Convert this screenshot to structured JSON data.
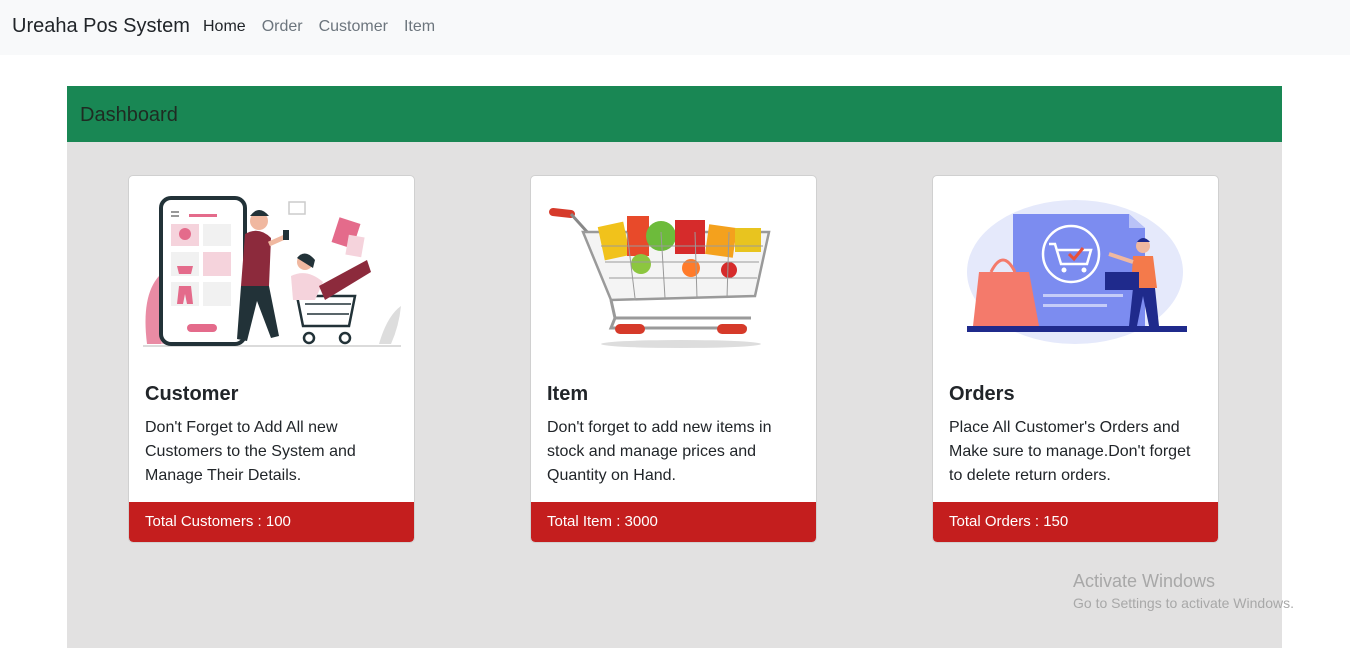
{
  "navbar": {
    "brand": "Ureaha Pos System",
    "links": [
      {
        "label": "Home",
        "active": true
      },
      {
        "label": "Order",
        "active": false
      },
      {
        "label": "Customer",
        "active": false
      },
      {
        "label": "Item",
        "active": false
      }
    ]
  },
  "dashboard": {
    "title": "Dashboard",
    "cards": [
      {
        "title": "Customer",
        "text": "Don't Forget to Add All new Customers to the System and Manage Their Details.",
        "footer_label": "Total Customers : ",
        "footer_value": "100",
        "image_icon": "online-shopping-illustration"
      },
      {
        "title": "Item",
        "text": "Don't forget to add new items in stock and manage prices and Quantity on Hand.",
        "footer_label": "Total Item : ",
        "footer_value": "3000",
        "image_icon": "shopping-cart-illustration"
      },
      {
        "title": "Orders",
        "text": "Place All Customer's Orders and Make sure to manage.Don't forget to delete return orders.",
        "footer_label": "Total Orders : ",
        "footer_value": "150",
        "image_icon": "order-checkout-illustration"
      }
    ]
  },
  "watermark": {
    "title": "Activate Windows",
    "subtitle": "Go to Settings to activate Windows."
  },
  "colors": {
    "header_green": "#198754",
    "footer_red": "#c41e1e",
    "body_gray": "#e2e1e1"
  }
}
